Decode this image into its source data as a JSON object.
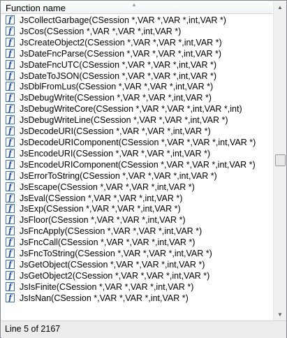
{
  "header": {
    "label": "Function name"
  },
  "rows": [
    "JsCollectGarbage(CSession *,VAR *,VAR *,int,VAR *)",
    "JsCos(CSession *,VAR *,VAR *,int,VAR *)",
    "JsCreateObject2(CSession *,VAR *,VAR *,int,VAR *)",
    "JsDateFncParse(CSession *,VAR *,VAR *,int,VAR *)",
    "JsDateFncUTC(CSession *,VAR *,VAR *,int,VAR *)",
    "JsDateToJSON(CSession *,VAR *,VAR *,int,VAR *)",
    "JsDblFromLus(CSession *,VAR *,VAR *,int,VAR *)",
    "JsDebugWrite(CSession *,VAR *,VAR *,int,VAR *)",
    "JsDebugWriteCore(CSession *,VAR *,VAR *,int,VAR *,int)",
    "JsDebugWriteLine(CSession *,VAR *,VAR *,int,VAR *)",
    "JsDecodeURI(CSession *,VAR *,VAR *,int,VAR *)",
    "JsDecodeURIComponent(CSession *,VAR *,VAR *,int,VAR *)",
    "JsEncodeURI(CSession *,VAR *,VAR *,int,VAR *)",
    "JsEncodeURIComponent(CSession *,VAR *,VAR *,int,VAR *)",
    "JsErrorToString(CSession *,VAR *,VAR *,int,VAR *)",
    "JsEscape(CSession *,VAR *,VAR *,int,VAR *)",
    "JsEval(CSession *,VAR *,VAR *,int,VAR *)",
    "JsExp(CSession *,VAR *,VAR *,int,VAR *)",
    "JsFloor(CSession *,VAR *,VAR *,int,VAR *)",
    "JsFncApply(CSession *,VAR *,VAR *,int,VAR *)",
    "JsFncCall(CSession *,VAR *,VAR *,int,VAR *)",
    "JsFncToString(CSession *,VAR *,VAR *,int,VAR *)",
    "JsGetObject(CSession *,VAR *,VAR *,int,VAR *)",
    "JsGetObject2(CSession *,VAR *,VAR *,int,VAR *)",
    "JsIsFinite(CSession *,VAR *,VAR *,int,VAR *)",
    "JsIsNan(CSession *,VAR *,VAR *,int,VAR *)"
  ],
  "icon": {
    "glyph": "f",
    "name": "function-icon"
  },
  "status": {
    "text": "Line 5 of 2167"
  }
}
